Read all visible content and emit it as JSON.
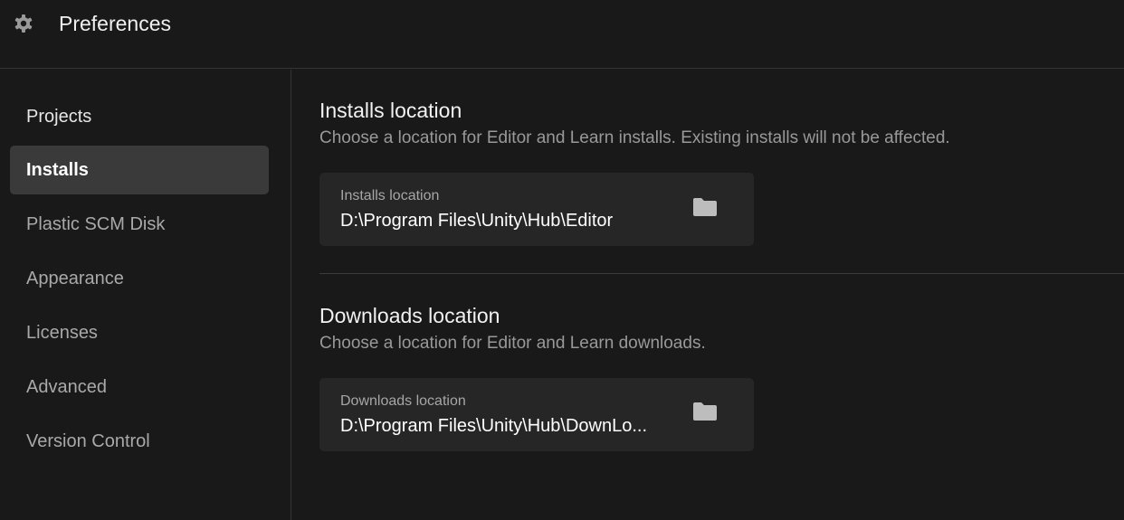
{
  "header": {
    "icon": "gear-icon",
    "title": "Preferences"
  },
  "sidebar": {
    "items": [
      {
        "label": "Projects",
        "active": false
      },
      {
        "label": "Installs",
        "active": true
      },
      {
        "label": "Plastic SCM Disk",
        "active": false
      },
      {
        "label": "Appearance",
        "active": false
      },
      {
        "label": "Licenses",
        "active": false
      },
      {
        "label": "Advanced",
        "active": false
      },
      {
        "label": "Version Control",
        "active": false
      }
    ]
  },
  "main": {
    "installs": {
      "title": "Installs location",
      "description": "Choose a location for Editor and Learn installs. Existing installs will not be affected.",
      "field_label": "Installs location",
      "field_value": "D:\\Program Files\\Unity\\Hub\\Editor",
      "icon": "folder-icon"
    },
    "downloads": {
      "title": "Downloads location",
      "description": "Choose a location for Editor and Learn downloads.",
      "field_label": "Downloads location",
      "field_value": "D:\\Program Files\\Unity\\Hub\\DownLo...",
      "icon": "folder-icon"
    }
  },
  "colors": {
    "background": "#191919",
    "active_item": "#3a3a3a",
    "field_bg": "#262626",
    "border": "#343434"
  }
}
